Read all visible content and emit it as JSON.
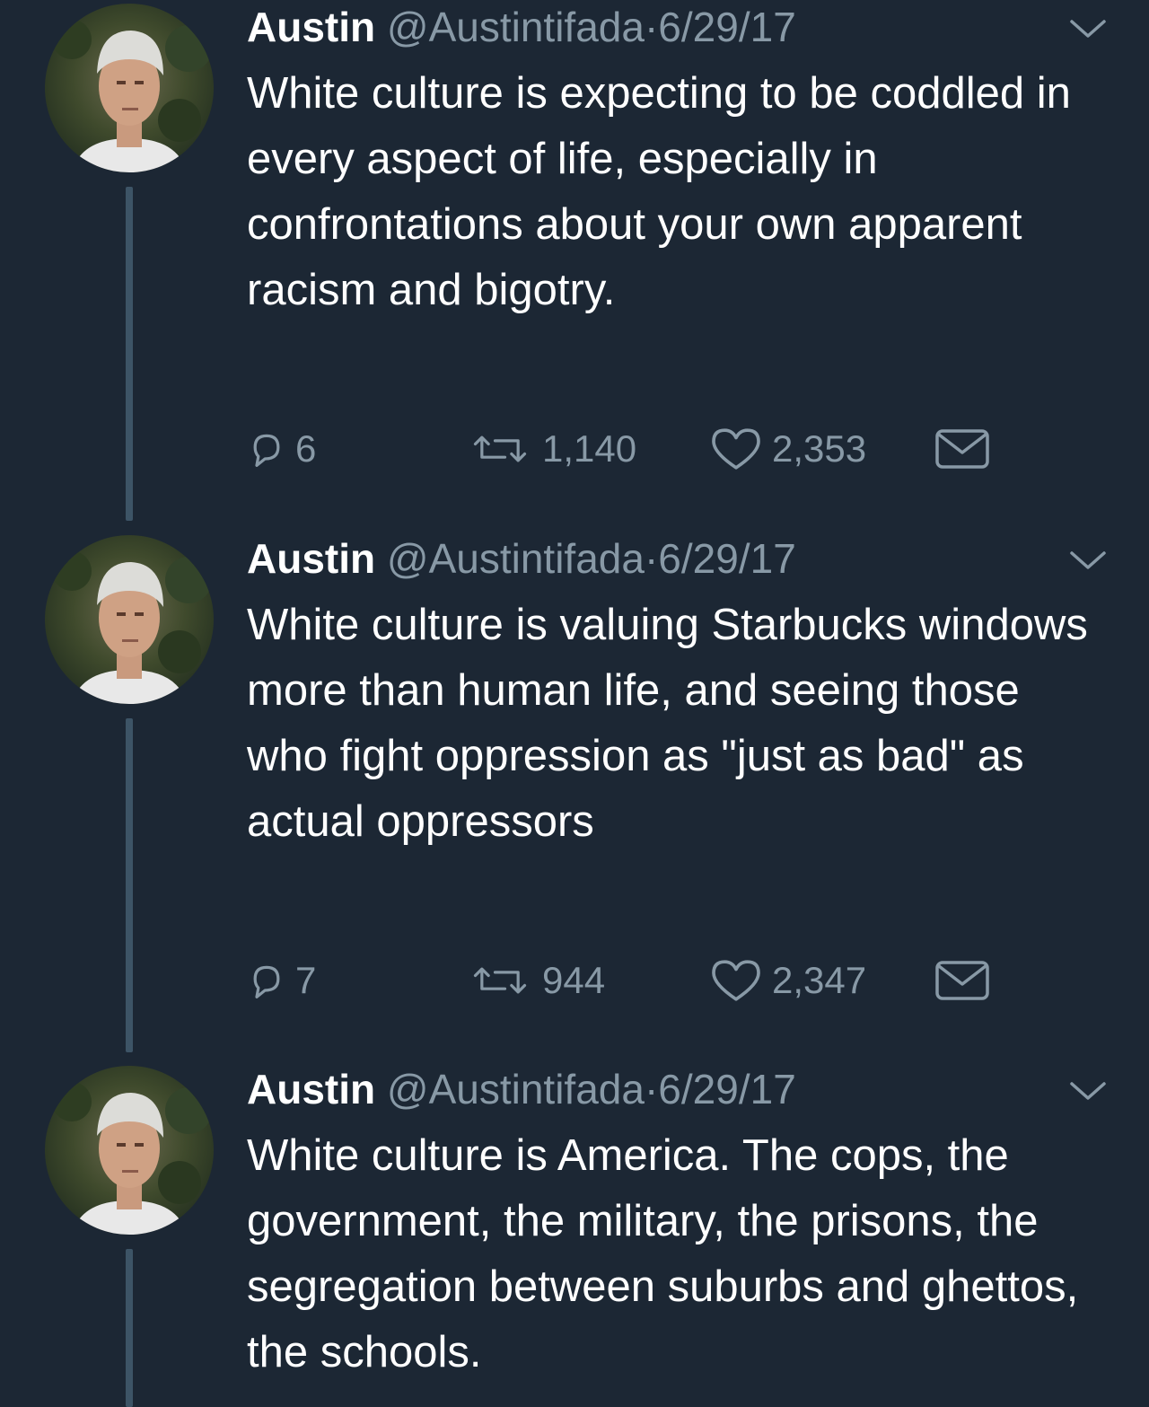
{
  "colors": {
    "background": "#1c2734",
    "secondary_text": "#8899a6",
    "primary_text": "#ffffff",
    "thread_line": "#3d5466"
  },
  "tweets": [
    {
      "name": "Austin",
      "handle": "@Austintifada",
      "separator": "·",
      "date": "6/29/17",
      "text": "White culture is expecting to be coddled in every aspect of life, especially in confrontations about your own apparent racism and bigotry.",
      "replies": "6",
      "retweets": "1,140",
      "likes": "2,353"
    },
    {
      "name": "Austin",
      "handle": "@Austintifada",
      "separator": "·",
      "date": "6/29/17",
      "text": "White culture is valuing Starbucks windows more than human life, and seeing those who fight oppression as \"just as bad\" as actual oppressors",
      "replies": "7",
      "retweets": "944",
      "likes": "2,347"
    },
    {
      "name": "Austin",
      "handle": "@Austintifada",
      "separator": "·",
      "date": "6/29/17",
      "text": "White culture is America. The cops, the government, the military, the prisons, the segregation between suburbs and ghettos, the schools."
    }
  ]
}
